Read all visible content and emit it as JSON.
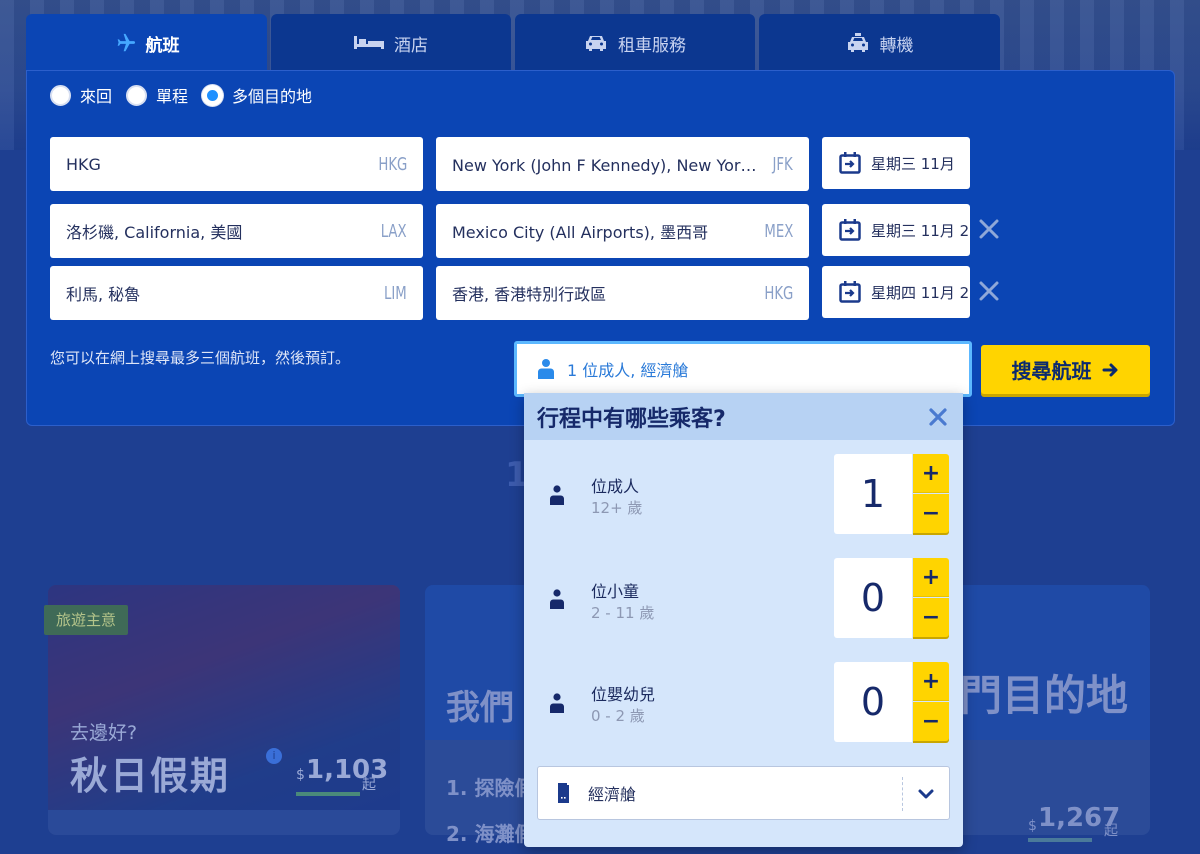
{
  "tabs": [
    {
      "label": "航班",
      "icon": "airplane-icon",
      "active": true
    },
    {
      "label": "酒店",
      "icon": "bed-icon",
      "active": false
    },
    {
      "label": "租車服務",
      "icon": "car-icon",
      "active": false
    },
    {
      "label": "轉機",
      "icon": "taxi-icon",
      "active": false
    }
  ],
  "trip_types": [
    {
      "label": "來回",
      "checked": false
    },
    {
      "label": "單程",
      "checked": false
    },
    {
      "label": "多個目的地",
      "checked": true
    }
  ],
  "legs": [
    {
      "from": "HKG",
      "from_code": "HKG",
      "to": "New York (John F Kennedy), New York, 美國",
      "to_code": "JFK",
      "date": "星期三 11月",
      "removable": false
    },
    {
      "from": "洛杉磯, California, 美國",
      "from_code": "LAX",
      "to": "Mexico City (All Airports), 墨西哥",
      "to_code": "MEX",
      "date": "星期三 11月 2",
      "removable": true
    },
    {
      "from": "利馬, 秘魯",
      "from_code": "LIM",
      "to": "香港, 香港特別行政區",
      "to_code": "HKG",
      "date": "星期四 11月 2",
      "removable": true
    }
  ],
  "hint": "您可以在網上搜尋最多三個航班，然後預訂。",
  "passenger_summary": "1 位成人, 經濟艙",
  "search_button": "搜尋航班",
  "popup": {
    "title": "行程中有哪些乘客?",
    "rows": [
      {
        "label": "位成人",
        "age": "12+ 歲",
        "count": "1"
      },
      {
        "label": "位小童",
        "age": "2 - 11 歲",
        "count": "0"
      },
      {
        "label": "位嬰幼兒",
        "age": "0 - 2 歲",
        "count": "0"
      }
    ],
    "plus": "+",
    "minus": "−",
    "cabin": "經濟艙"
  },
  "background": {
    "badge": "旅遊主意",
    "card1_sub": "去邊好?",
    "card1_title": "秋日假期",
    "card1_info": "i",
    "card1_price_currency": "$",
    "card1_price": "1,103",
    "card1_price_suffix": "起",
    "headline_fragment": "1",
    "card2_title_left": "我們",
    "card2_title_right": "門目的地",
    "card2_item1": "1. 探險假",
    "card2_item2": "2. 海灘假",
    "card2_price_currency": "$",
    "card2_price": "1,267",
    "card2_price_suffix": "起"
  },
  "colors": {
    "page_bg": "#1e3f91",
    "panel": "#0b45b4",
    "tab_inactive": "#0c3790",
    "accent_yellow": "#ffd400",
    "popup_bg": "#d5e6fb",
    "popup_header": "#b7d2f3",
    "focus_border": "#5cb8ff"
  }
}
